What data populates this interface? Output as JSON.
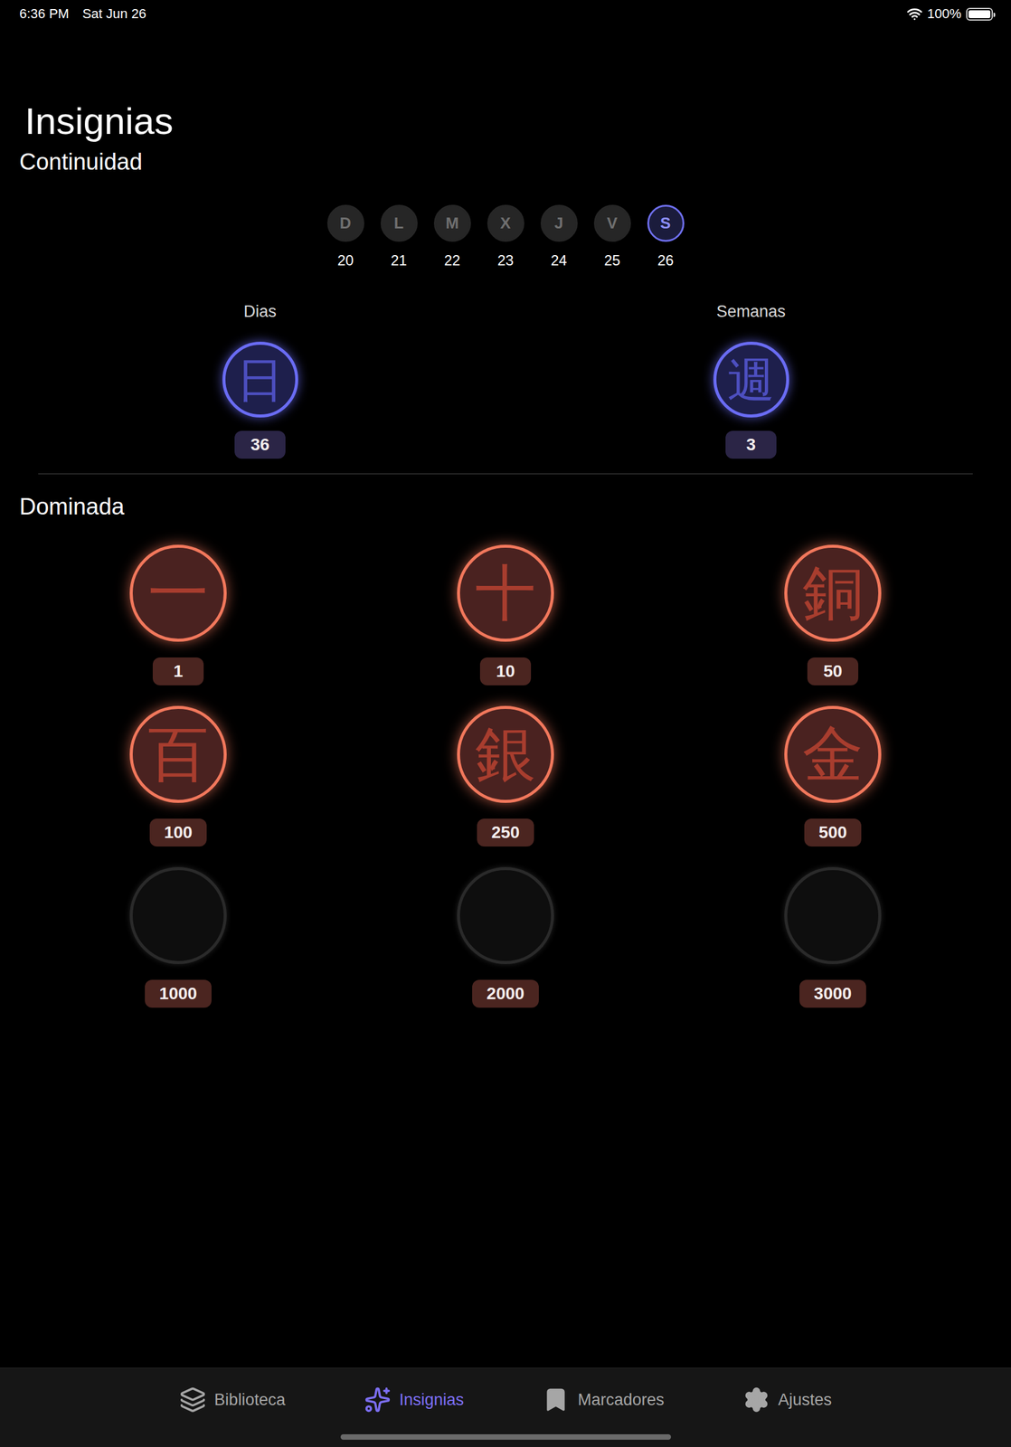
{
  "status_bar": {
    "time": "6:36 PM",
    "date": "Sat Jun 26",
    "battery": "100%",
    "battery_level": 1
  },
  "title": "Insignias",
  "continuity": {
    "heading": "Continuidad",
    "days": [
      {
        "letter": "D",
        "date": "20",
        "selected": false
      },
      {
        "letter": "L",
        "date": "21",
        "selected": false
      },
      {
        "letter": "M",
        "date": "22",
        "selected": false
      },
      {
        "letter": "X",
        "date": "23",
        "selected": false
      },
      {
        "letter": "J",
        "date": "24",
        "selected": false
      },
      {
        "letter": "V",
        "date": "25",
        "selected": false
      },
      {
        "letter": "S",
        "date": "26",
        "selected": true
      }
    ],
    "streaks": [
      {
        "label": "Dias",
        "glyph": "日",
        "count": "36"
      },
      {
        "label": "Semanas",
        "glyph": "週",
        "count": "3"
      }
    ]
  },
  "mastery": {
    "heading": "Dominada",
    "badges": [
      {
        "glyph": "一",
        "count": "1",
        "earned": true
      },
      {
        "glyph": "十",
        "count": "10",
        "earned": true
      },
      {
        "glyph": "銅",
        "count": "50",
        "earned": true
      },
      {
        "glyph": "百",
        "count": "100",
        "earned": true
      },
      {
        "glyph": "銀",
        "count": "250",
        "earned": true
      },
      {
        "glyph": "金",
        "count": "500",
        "earned": true
      },
      {
        "glyph": "",
        "count": "1000",
        "earned": false
      },
      {
        "glyph": "",
        "count": "2000",
        "earned": false
      },
      {
        "glyph": "",
        "count": "3000",
        "earned": false
      }
    ]
  },
  "tabs": [
    {
      "label": "Biblioteca",
      "selected": false
    },
    {
      "label": "Insignias",
      "selected": true
    },
    {
      "label": "Marcadores",
      "selected": false
    },
    {
      "label": "Ajustes",
      "selected": false
    }
  ]
}
